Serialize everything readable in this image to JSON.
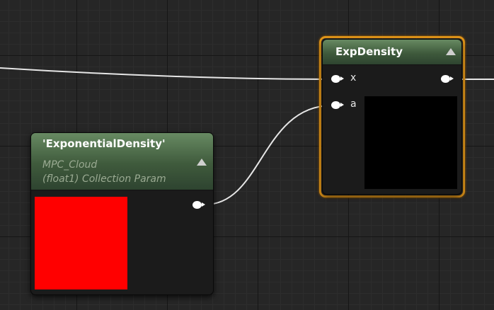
{
  "colors": {
    "graph_background": "#262626",
    "node_header": "#4a6647",
    "selection_outline": "#e89a1a",
    "wire": "#e6e6e6",
    "param_preview": "#ff0000",
    "exp_preview": "#000000"
  },
  "param_node": {
    "title": "'ExponentialDensity'",
    "collection": "MPC_Cloud",
    "type_label": "(float1) Collection Param",
    "preview_color": "#ff0000"
  },
  "exp_node": {
    "title": "ExpDensity",
    "inputs": [
      {
        "label": "x"
      },
      {
        "label": "a"
      }
    ],
    "selected": true
  }
}
